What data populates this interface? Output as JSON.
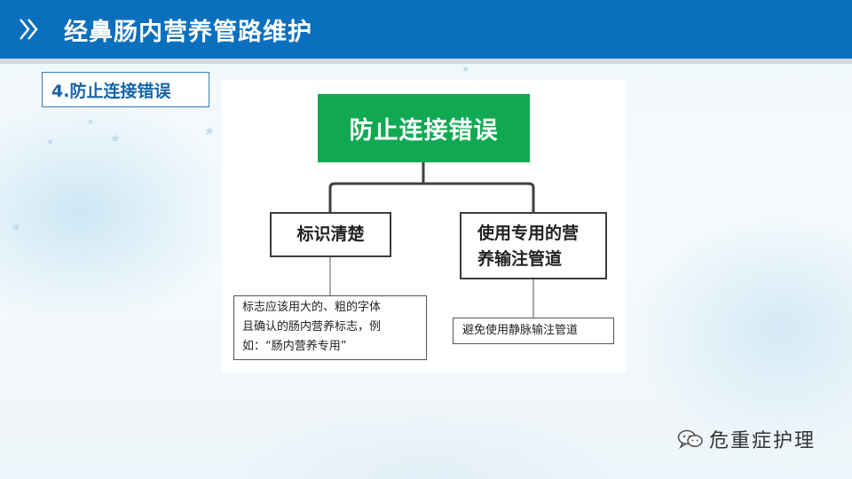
{
  "header": {
    "title": "经鼻肠内营养管路维护",
    "accent_color": "#0a70bd"
  },
  "section": {
    "tag": "4.防止连接错误"
  },
  "diagram": {
    "root": {
      "label": "防止连接错误",
      "color": "#10a952"
    },
    "branches": [
      {
        "label": "标识清楚",
        "detail_lines": [
          "标志应该用大的、粗的字体",
          "且确认的肠内营养标志，例",
          "如：“肠内营养专用”"
        ]
      },
      {
        "label_lines": [
          "使用专用的营",
          "养输注管道"
        ],
        "detail": "避免使用静脉输注管道"
      }
    ]
  },
  "watermark": {
    "text": "危重症护理",
    "icon": "chat-bubbles-icon"
  }
}
